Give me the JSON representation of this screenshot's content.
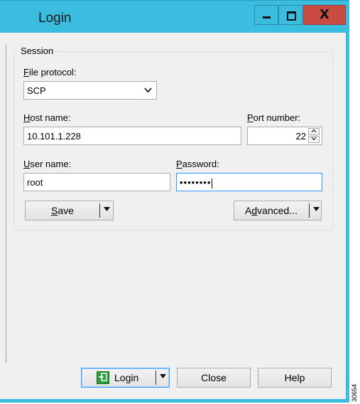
{
  "window": {
    "title": "Login",
    "minimize_glyph": "",
    "maximize_glyph": "",
    "close_glyph": "X"
  },
  "session": {
    "group_label": "Session",
    "file_protocol_label_first": "F",
    "file_protocol_label_rest": "ile protocol:",
    "file_protocol_value": "SCP",
    "host_label_first": "H",
    "host_label_rest": "ost name:",
    "host_value": "10.101.1.228",
    "port_label_first": "P",
    "port_label_rest": "ort number:",
    "port_value": "22",
    "user_label_first": "U",
    "user_label_rest": "ser name:",
    "user_value": "root",
    "password_label_first": "P",
    "password_label_rest": "assword:",
    "password_value": "••••••••",
    "save_label_first": "S",
    "save_label_rest": "ave",
    "advanced_label_pre": "A",
    "advanced_label_ul": "d",
    "advanced_label_rest": "vanced..."
  },
  "footer": {
    "login_label": "Login",
    "close_label": "Close",
    "help_label": "Help"
  },
  "side_note": "30654",
  "icons": {
    "dropdown": "chevron-down-icon",
    "spin_up": "spin-up-icon",
    "spin_down": "spin-down-icon",
    "login": "login-icon"
  }
}
